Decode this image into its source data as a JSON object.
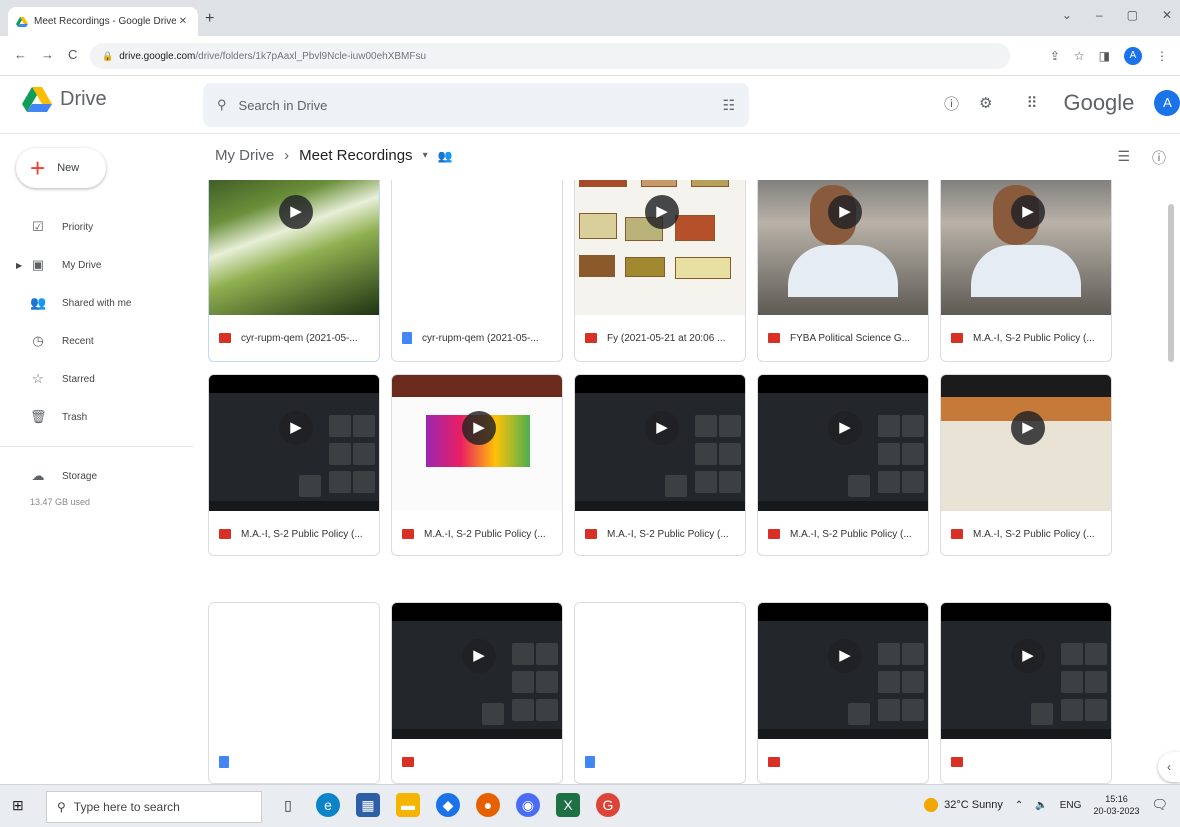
{
  "browser": {
    "tab_title": "Meet Recordings - Google Drive",
    "url_host": "drive.google.com",
    "url_path": "/drive/folders/1k7pAaxl_Pbvl9Ncle-iuw00ehXBMFsu",
    "profile_initial": "A"
  },
  "header": {
    "app_name": "Drive",
    "search_placeholder": "Search in Drive",
    "brand": "Google",
    "avatar_initial": "A"
  },
  "sidebar": {
    "new_label": "New",
    "items": [
      {
        "label": "Priority",
        "icon": "priority-icon"
      },
      {
        "label": "My Drive",
        "icon": "my-drive-icon"
      },
      {
        "label": "Shared with me",
        "icon": "shared-icon"
      },
      {
        "label": "Recent",
        "icon": "recent-icon"
      },
      {
        "label": "Starred",
        "icon": "star-icon"
      },
      {
        "label": "Trash",
        "icon": "trash-icon"
      }
    ],
    "storage_label": "Storage",
    "storage_used": "13.47 GB used"
  },
  "breadcrumb": {
    "root": "My Drive",
    "current": "Meet Recordings"
  },
  "files": [
    {
      "name": "cyr-rupm-qem (2021-05-...",
      "type": "video",
      "thumb": "flower"
    },
    {
      "name": "cyr-rupm-qem (2021-05-...",
      "type": "doc",
      "thumb": "blank"
    },
    {
      "name": "Fy (2021-05-21 at 20:06 ...",
      "type": "video",
      "thumb": "diagram"
    },
    {
      "name": "FYBA Political Science G...",
      "type": "video",
      "thumb": "man"
    },
    {
      "name": "M.A.-I, S-2 Public Policy (...",
      "type": "video",
      "thumb": "man"
    },
    {
      "name": "M.A.-I, S-2 Public Policy (...",
      "type": "video",
      "thumb": "dark"
    },
    {
      "name": "M.A.-I, S-2 Public Policy (...",
      "type": "video",
      "thumb": "welcome"
    },
    {
      "name": "M.A.-I, S-2 Public Policy (...",
      "type": "video",
      "thumb": "dark"
    },
    {
      "name": "M.A.-I, S-2 Public Policy (...",
      "type": "video",
      "thumb": "dark"
    },
    {
      "name": "M.A.-I, S-2 Public Policy (...",
      "type": "video",
      "thumb": "slide"
    },
    {
      "name": "",
      "type": "doc",
      "thumb": "blank"
    },
    {
      "name": "",
      "type": "video",
      "thumb": "dark"
    },
    {
      "name": "",
      "type": "doc",
      "thumb": "blank"
    },
    {
      "name": "",
      "type": "video",
      "thumb": "dark"
    },
    {
      "name": "",
      "type": "video",
      "thumb": "dark"
    }
  ],
  "taskbar": {
    "search_placeholder": "Type here to search",
    "weather": "32°C  Sunny",
    "lang": "ENG",
    "time": "15:16",
    "date": "20-03-2023"
  }
}
